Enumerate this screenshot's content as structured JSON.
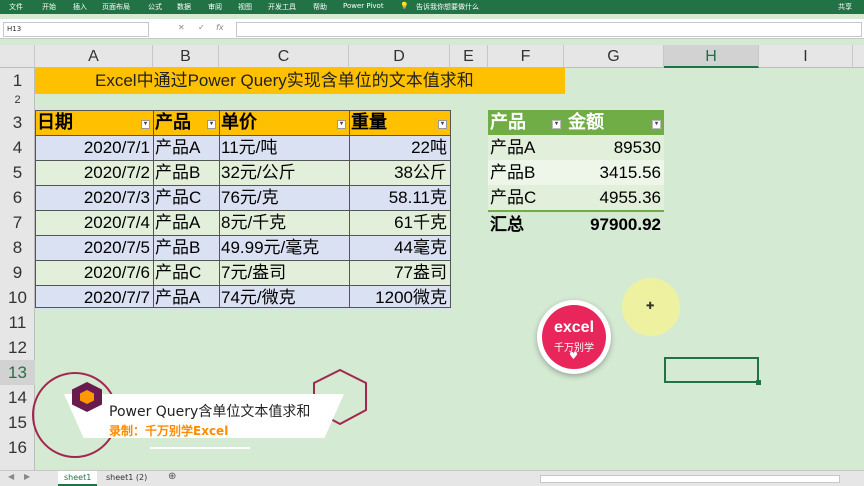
{
  "ribbon": {
    "tabs": [
      "文件",
      "开始",
      "插入",
      "页面布局",
      "公式",
      "数据",
      "审阅",
      "视图",
      "开发工具",
      "帮助",
      "Power Pivot"
    ],
    "tell_me": "告诉我你想要做什么",
    "share": "共享"
  },
  "formula_bar": {
    "name_box": "H13",
    "cancel": "✕",
    "enter": "✓",
    "fx": "fx",
    "value": ""
  },
  "columns": [
    "A",
    "B",
    "C",
    "D",
    "E",
    "F",
    "G",
    "H",
    "I"
  ],
  "rows": [
    "1",
    "2",
    "3",
    "4",
    "5",
    "6",
    "7",
    "8",
    "9",
    "10",
    "11",
    "12",
    "13",
    "14",
    "15",
    "16"
  ],
  "title": "Excel中通过Power Query实现含单位的文本值求和",
  "table1": {
    "headers": [
      "日期",
      "产品",
      "单价",
      "重量"
    ],
    "rows": [
      [
        "2020/7/1",
        "产品A",
        "11元/吨",
        "22吨"
      ],
      [
        "2020/7/2",
        "产品B",
        "32元/公斤",
        "38公斤"
      ],
      [
        "2020/7/3",
        "产品C",
        "76元/克",
        "58.11克"
      ],
      [
        "2020/7/4",
        "产品A",
        "8元/千克",
        "61千克"
      ],
      [
        "2020/7/5",
        "产品B",
        "49.99元/毫克",
        "44毫克"
      ],
      [
        "2020/7/6",
        "产品C",
        "7元/盎司",
        "77盎司"
      ],
      [
        "2020/7/7",
        "产品A",
        "74元/微克",
        "1200微克"
      ]
    ]
  },
  "table2": {
    "headers": [
      "产品",
      "金额"
    ],
    "rows": [
      [
        "产品A",
        "89530"
      ],
      [
        "产品B",
        "3415.56"
      ],
      [
        "产品C",
        "4955.36"
      ]
    ],
    "total": [
      "汇总",
      "97900.92"
    ]
  },
  "logo": {
    "text": "excel",
    "sub": "千万别学",
    "heart": "♥"
  },
  "banner": {
    "title": "Power Query含单位文本值求和",
    "subtitle": "录制：千万别学Excel"
  },
  "sheets": [
    "sheet1",
    "sheet1 (2)"
  ],
  "add_sheet": "⊕",
  "colors": {
    "ribbon": "#217346",
    "header_fill": "#ffc000",
    "table2_header": "#70ad47",
    "band_blue": "#d9e1f2",
    "band_green": "#e2efda",
    "logo": "#e8265b",
    "banner_subtitle": "#ff8c00"
  }
}
